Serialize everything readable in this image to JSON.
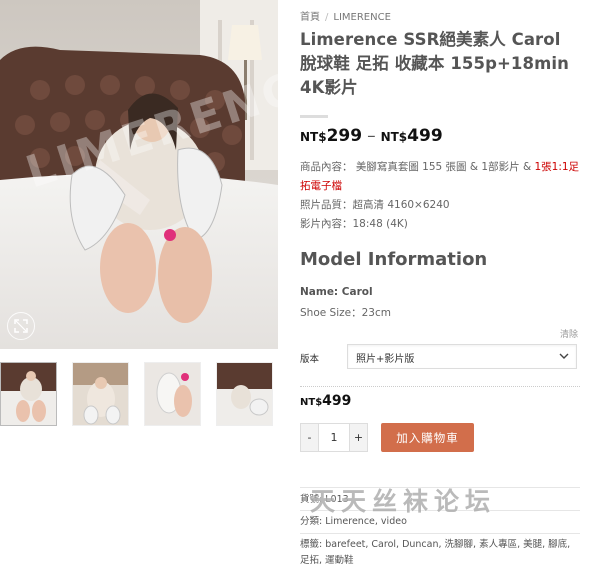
{
  "gallery": {
    "main_watermark": "LIMERENCE",
    "zoom_icon": "expand-icon",
    "thumbnails": [
      {
        "name": "thumb-1",
        "active": true
      },
      {
        "name": "thumb-2",
        "active": false
      },
      {
        "name": "thumb-3",
        "active": false
      },
      {
        "name": "thumb-4",
        "active": false
      }
    ]
  },
  "breadcrumb": {
    "home": "首頁",
    "separator": "/",
    "category": "LIMERENCE"
  },
  "product": {
    "title": "Limerence SSR絕美素人 Carol 脫球鞋 足拓 收藏本 155p+18min 4K影片",
    "price_range": {
      "currency": "NT$",
      "min": "299",
      "dash": "–",
      "max": "499"
    },
    "description": {
      "content_label": "商品內容：",
      "content_text": "美腳寫真套圖 155 張圖 & 1部影片 & ",
      "content_red": "1張1:1足拓電子檔",
      "quality_label": "照片品質：",
      "quality_text": "超高清 4160×6240",
      "video_label": "影片內容：",
      "video_text": "18:48 (4K)"
    },
    "model_heading": "Model Information",
    "model_name": "Name: Carol",
    "shoe_size": "Shoe Size：23cm"
  },
  "variation": {
    "clear_label": "清除",
    "label": "版本",
    "selected": "照片+影片版",
    "chevron_icon": "chevron-down-icon"
  },
  "cart": {
    "price_currency": "NT$",
    "price": "499",
    "minus": "-",
    "quantity": "1",
    "plus": "+",
    "add_label": "加入購物車"
  },
  "meta": {
    "sku_label": "貨號:",
    "sku": "L013",
    "category_label": "分類:",
    "categories": "Limerence, video",
    "tags_label": "標籤:",
    "tags": "barefeet, Carol, Duncan, 洗腳腳, 素人專區, 美腿, 腳底, 足拓, 運動鞋"
  },
  "overlay_watermark": "天天丝袜论坛",
  "colors": {
    "accent": "#d26e4b",
    "price": "#111111",
    "red_text": "#cc0000"
  }
}
